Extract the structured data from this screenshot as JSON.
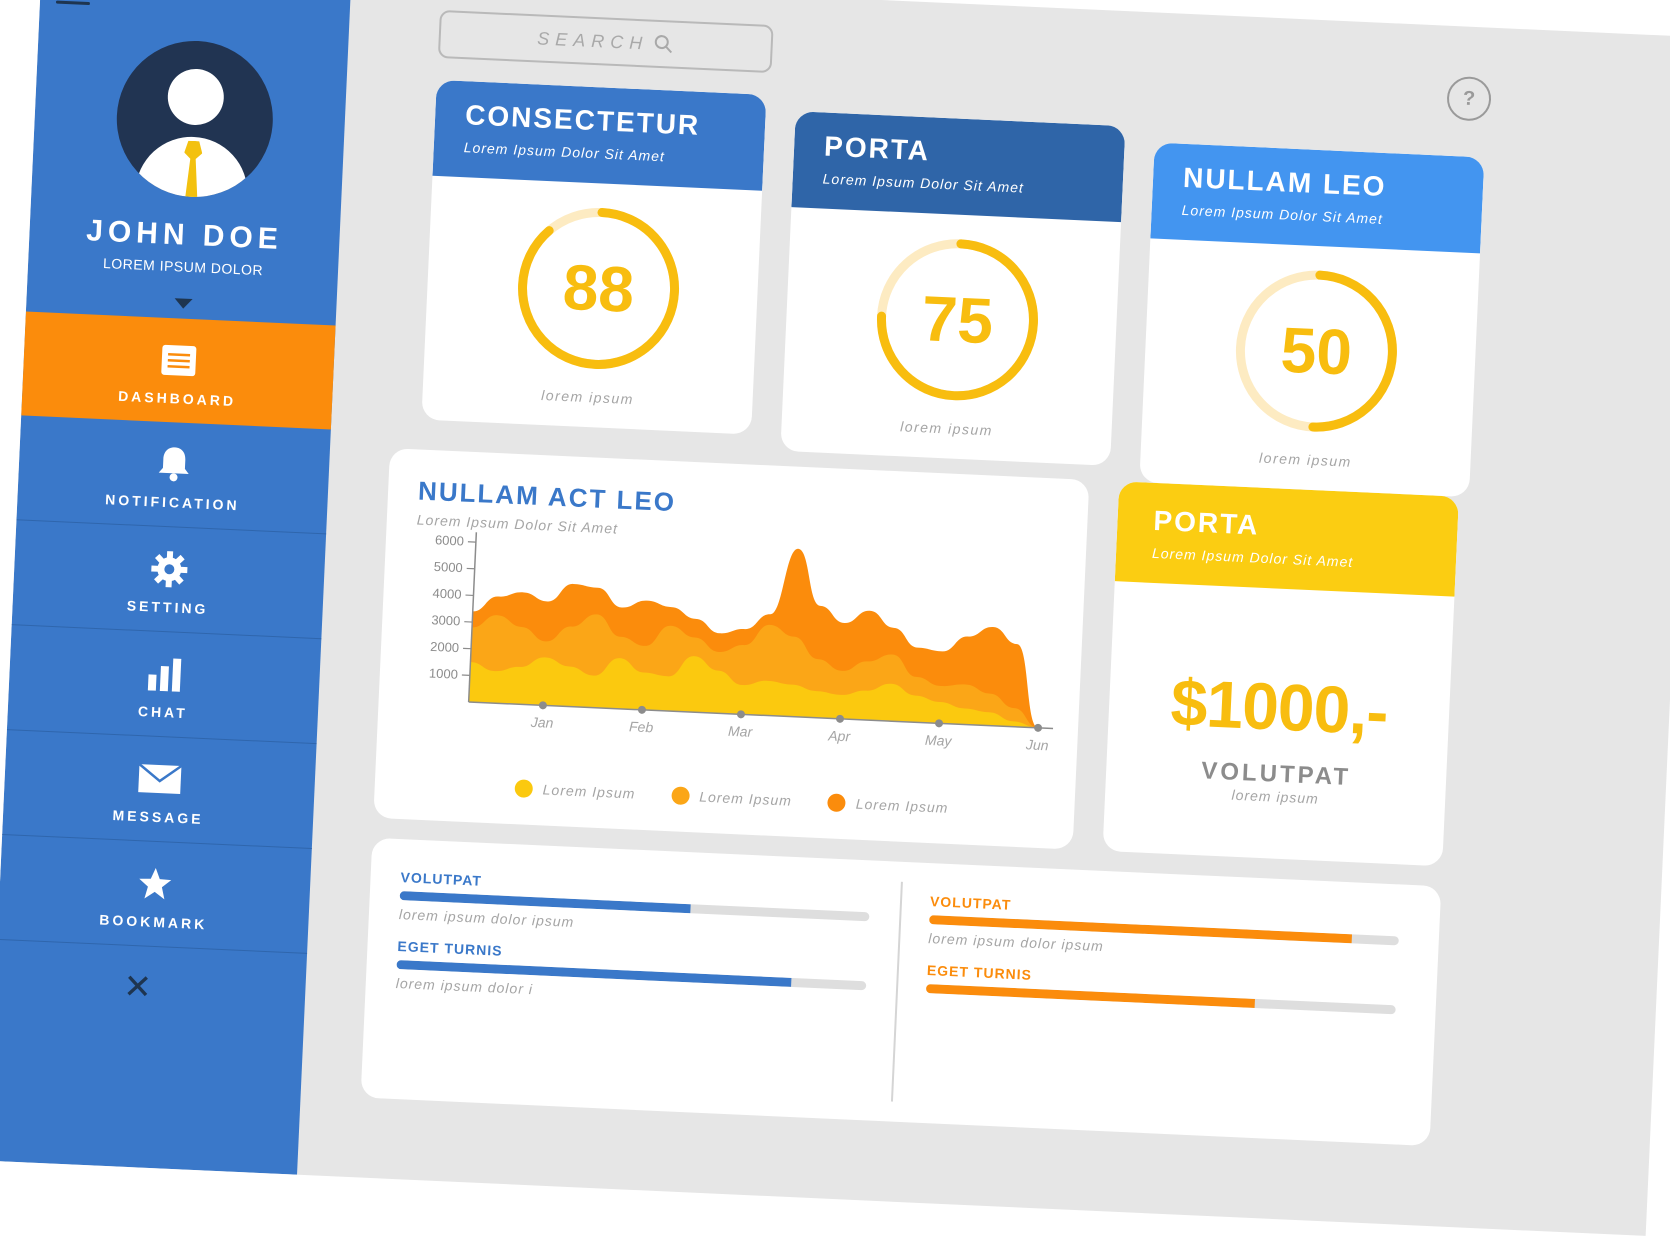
{
  "user": {
    "name": "JOHN DOE",
    "subtitle": "LOREM IPSUM DOLOR"
  },
  "nav": [
    {
      "label": "DASHBOARD",
      "icon": "list-icon",
      "active": true
    },
    {
      "label": "NOTIFICATION",
      "icon": "bell-icon"
    },
    {
      "label": "SETTING",
      "icon": "gear-icon"
    },
    {
      "label": "CHAT",
      "icon": "bar-chart-icon"
    },
    {
      "label": "MESSAGE",
      "icon": "envelope-icon"
    },
    {
      "label": "BOOKMARK",
      "icon": "star-icon"
    }
  ],
  "search": {
    "placeholder": "SEARCH"
  },
  "help": {
    "label": "?"
  },
  "cards": [
    {
      "title": "CONSECTETUR",
      "subtitle": "Lorem Ipsum Dolor Sit Amet",
      "value": "88",
      "progress": 0.88,
      "caption": "lorem ipsum",
      "color": "#3a78c9"
    },
    {
      "title": "PORTA",
      "subtitle": "Lorem Ipsum Dolor Sit Amet",
      "value": "75",
      "progress": 0.75,
      "caption": "lorem ipsum",
      "color": "#2f65a8"
    },
    {
      "title": "NULLAM LEO",
      "subtitle": "Lorem Ipsum Dolor Sit Amet",
      "value": "50",
      "progress": 0.5,
      "caption": "lorem ipsum",
      "color": "#4395f0"
    }
  ],
  "chart": {
    "title": "NULLAM ACT LEO",
    "subtitle": "Lorem Ipsum Dolor Sit Amet"
  },
  "chart_data": {
    "type": "area",
    "x": [
      0,
      0.25,
      0.5,
      0.75,
      1,
      1.25,
      1.5,
      1.75,
      2,
      2.25,
      2.5,
      2.75,
      3,
      3.25,
      3.5,
      3.75,
      4,
      4.25,
      4.5,
      4.75,
      5,
      5.25,
      5.5,
      5.75
    ],
    "categories": [
      "Jan",
      "Feb",
      "Mar",
      "Apr",
      "May",
      "Jun"
    ],
    "ylim": [
      0,
      6000
    ],
    "yticks": [
      1000,
      2000,
      3000,
      4000,
      5000,
      6000
    ],
    "series": [
      {
        "name": "Lorem Ipsum",
        "color": "#fbc90f",
        "values": [
          1500,
          1200,
          1400,
          1800,
          1500,
          1200,
          1900,
          1400,
          1300,
          2100,
          1600,
          1100,
          1300,
          1200,
          1000,
          900,
          1100,
          1400,
          1000,
          800,
          600,
          500,
          200,
          0
        ]
      },
      {
        "name": "Lorem Ipsum",
        "color": "#fba617",
        "values": [
          2800,
          3300,
          2900,
          2400,
          3000,
          3500,
          2700,
          2400,
          3200,
          2800,
          2300,
          2600,
          3400,
          3000,
          2200,
          1800,
          2200,
          2500,
          1700,
          1400,
          1500,
          1200,
          700,
          0
        ]
      },
      {
        "name": "Lorem Ipsum",
        "color": "#fb8c0c",
        "values": [
          3400,
          4000,
          4200,
          3900,
          4600,
          4500,
          3800,
          4100,
          3900,
          3500,
          3000,
          3200,
          3800,
          6300,
          4200,
          3600,
          4100,
          3500,
          2800,
          2700,
          3300,
          3700,
          3100,
          0
        ]
      }
    ]
  },
  "money": {
    "title": "PORTA",
    "subtitle": "Lorem Ipsum Dolor Sit Amet",
    "amount": "$1000,-",
    "label": "VOLUTPAT",
    "caption": "lorem ipsum"
  },
  "progress": {
    "left": [
      {
        "label": "VOLUTPAT",
        "caption": "lorem ipsum dolor ipsum",
        "value": 0.62,
        "color": "#3a78c9"
      },
      {
        "label": "EGET TURNIS",
        "caption": "lorem ipsum dolor i",
        "value": 0.84,
        "color": "#3a78c9"
      }
    ],
    "right": [
      {
        "label": "VOLUTPAT",
        "caption": "lorem ipsum dolor ipsum",
        "value": 0.9,
        "color": "#fb8c0c"
      },
      {
        "label": "EGET TURNIS",
        "caption": "",
        "value": 0.7,
        "color": "#fb8c0c"
      }
    ]
  }
}
